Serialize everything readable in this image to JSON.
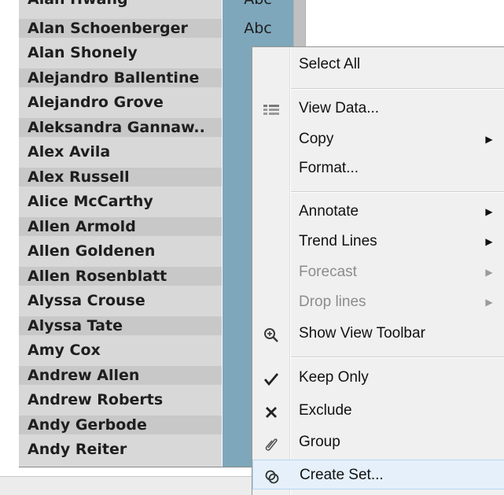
{
  "names": [
    "Alan Hwang",
    "Alan Schoenberger",
    "Alan Shonely",
    "Alejandro Ballentine",
    "Alejandro Grove",
    "Aleksandra Gannaw..",
    "Alex Avila",
    "Alex Russell",
    "Alice McCarthy",
    "Allen Armold",
    "Allen Goldenen",
    "Allen Rosenblatt",
    "Alyssa Crouse",
    "Alyssa Tate",
    "Amy Cox",
    "Andrew Allen",
    "Andrew Roberts",
    "Andy Gerbode",
    "Andy Reiter"
  ],
  "value_col": {
    "abc": "Abc"
  },
  "context_menu": {
    "select_all": "Select All",
    "view_data": "View Data...",
    "copy": "Copy",
    "format": "Format...",
    "annotate": "Annotate",
    "trend_lines": "Trend Lines",
    "forecast": "Forecast",
    "drop_lines": "Drop lines",
    "show_view_toolbar": "Show View Toolbar",
    "keep_only": "Keep Only",
    "exclude": "Exclude",
    "group": "Group",
    "create_set": "Create Set..."
  },
  "icons": {
    "view_data": "table-grid-icon",
    "show_view_toolbar": "zoom-in-icon",
    "keep_only": "checkmark-icon",
    "exclude": "x-mark-icon",
    "group": "paperclip-icon",
    "create_set": "set-circles-icon"
  },
  "colors": {
    "value_column": "#7ea7bb",
    "row_light": "#d8d8d8",
    "row_dark": "#c8c8c8",
    "menu_background": "#f0f0f0",
    "menu_hover": "#e5f0fa"
  }
}
